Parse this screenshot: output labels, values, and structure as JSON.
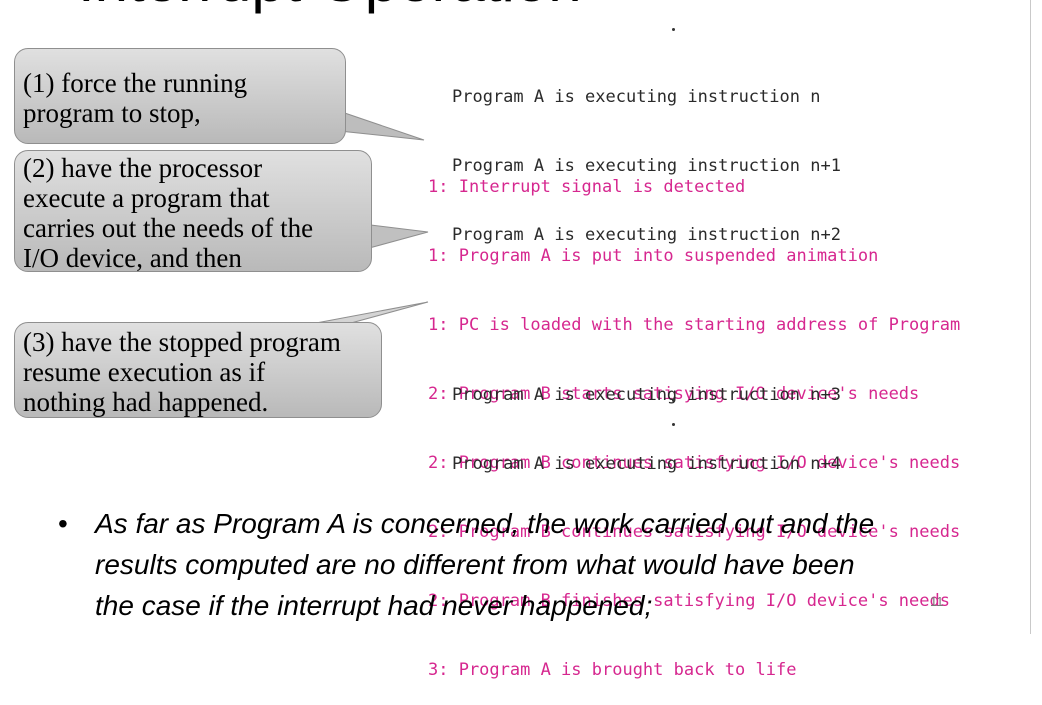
{
  "slide": {
    "title": "Interrupt Operation",
    "number": "11"
  },
  "callouts": [
    {
      "lines": [
        "(1) force the running",
        "program to stop,"
      ]
    },
    {
      "lines": [
        "(2) have the processor",
        "execute a program that",
        "carries out the needs of the",
        "I/O device, and then"
      ]
    },
    {
      "lines": [
        "(3) have the stopped program",
        "resume execution as if",
        "nothing had happened."
      ]
    }
  ],
  "code": {
    "before": [
      "Program A is executing instruction n",
      "Program A is executing instruction n+1",
      "Program A is executing instruction n+2"
    ],
    "interrupt": [
      "1: Interrupt signal is detected",
      "1: Program A is put into suspended animation",
      "1: PC is loaded with the starting address of Program",
      "2: Program B starts satisying I/O device's needs",
      "2: Program B continues satisfying I/O device's needs",
      "2: Program B continues satisfying I/O device's needs",
      "2: Program B finishes satisfying I/O device's needs",
      "3: Program A is brought back to life"
    ],
    "after": [
      "Program A is executing instruction n+3",
      "Program A is executing instruction n+4"
    ]
  },
  "bullet": {
    "lines": [
      "As far as Program A is concerned, the work carried out and the",
      "results computed are no different from what would have been",
      "the case if the interrupt had never happened;"
    ]
  },
  "colors": {
    "interrupt_text": "#d6278f",
    "code_text": "#2a2a2a",
    "callout_fill": "#c8c8c8",
    "callout_border": "#8f8f8f"
  }
}
